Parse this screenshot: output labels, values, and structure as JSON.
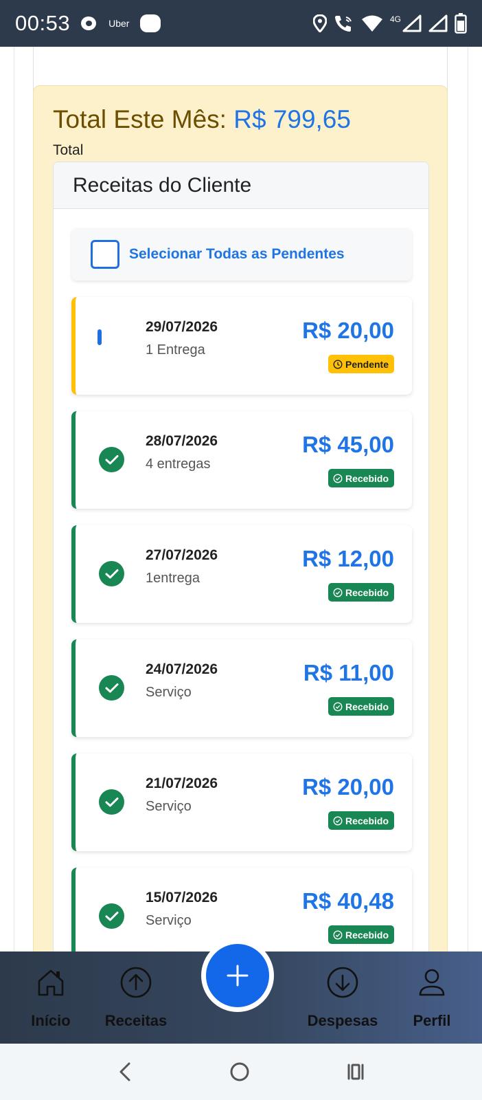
{
  "status_bar": {
    "time": "00:53",
    "app_label": "Uber",
    "network_type": "4G",
    "icons": [
      "chat-icon",
      "app-icon",
      "location-icon",
      "wifi-call-icon",
      "wifi-icon",
      "signal-icon",
      "battery-icon"
    ]
  },
  "month_summary": {
    "title": "Total Este Mês:",
    "amount": "R$ 799,65",
    "subtitle": "Total"
  },
  "receipts_panel": {
    "title": "Receitas do Cliente",
    "select_all_label": "Selecionar Todas as Pendentes",
    "items": [
      {
        "date": "29/07/2026",
        "description": "1 Entrega",
        "amount": "R$ 20,00",
        "status": "Pendente"
      },
      {
        "date": "28/07/2026",
        "description": "4 entregas",
        "amount": "R$ 45,00",
        "status": "Recebido"
      },
      {
        "date": "27/07/2026",
        "description": "1entrega",
        "amount": "R$ 12,00",
        "status": "Recebido"
      },
      {
        "date": "24/07/2026",
        "description": "Serviço",
        "amount": "R$ 11,00",
        "status": "Recebido"
      },
      {
        "date": "21/07/2026",
        "description": "Serviço",
        "amount": "R$ 20,00",
        "status": "Recebido"
      },
      {
        "date": "15/07/2026",
        "description": "Serviço",
        "amount": "R$ 40,48",
        "status": "Recebido"
      }
    ]
  },
  "bottom_nav": {
    "items": [
      {
        "label": "Início",
        "icon": "home-icon"
      },
      {
        "label": "Receitas",
        "icon": "arrow-up-circle-icon"
      },
      {
        "label": "Despesas",
        "icon": "arrow-down-circle-icon"
      },
      {
        "label": "Perfil",
        "icon": "user-icon"
      }
    ],
    "fab_icon": "plus-icon"
  },
  "colors": {
    "status_bar": "#2d3a4c",
    "accent_blue": "#1f74e6",
    "month_card_bg": "#fdf1cc",
    "month_title": "#6b4e00",
    "received_green": "#198754",
    "pending_yellow": "#ffc107"
  }
}
